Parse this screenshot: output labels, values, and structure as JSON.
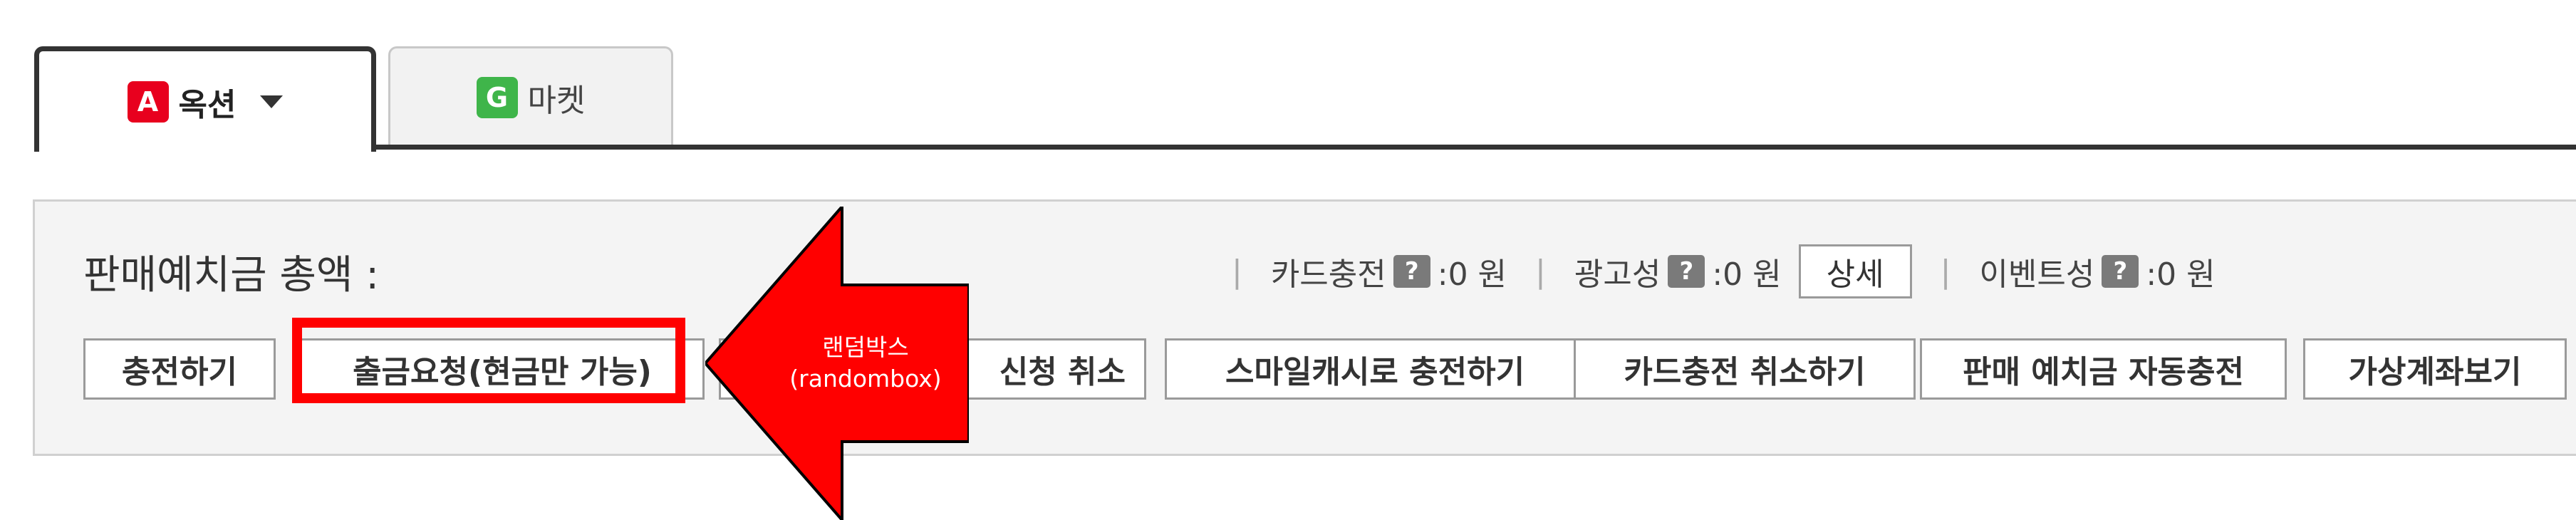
{
  "tabs": {
    "auction": {
      "logo": "A",
      "label": "옥션",
      "logo_color": "#e8001e"
    },
    "market": {
      "logo": "G",
      "label": "마켓",
      "logo_color": "#3fb54a"
    }
  },
  "deposit": {
    "total_label": "판매예치금 총액 :",
    "summary": {
      "card_charge_label": "카드충전",
      "card_charge_value": ":0 원",
      "ad_label": "광고성",
      "ad_value": ":0 원",
      "detail_button": "상세",
      "event_label": "이벤트성",
      "event_value": ":0 원",
      "separator": "|",
      "help_symbol": "?"
    },
    "buttons": {
      "charge": "충전하기",
      "withdraw_request": "출금요청(현금만 가능)",
      "cancel_request": "신청 취소",
      "smilecash_charge": "스마일캐시로 충전하기",
      "card_charge_cancel": "카드충전 취소하기",
      "auto_charge": "판매 예치금 자동충전",
      "virtual_account": "가상계좌보기"
    }
  },
  "annotation": {
    "arrow_text_line1": "랜덤박스",
    "arrow_text_line2": "(randombox)",
    "color": "#ff0000"
  }
}
